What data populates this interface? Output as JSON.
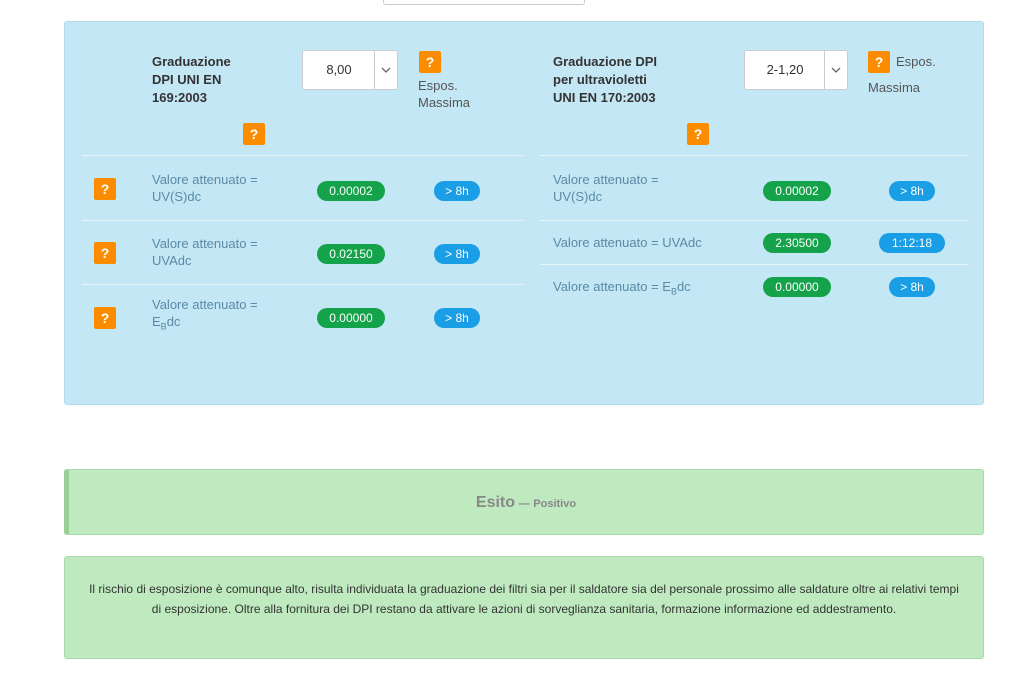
{
  "left": {
    "title_lines": [
      "Graduazione",
      "DPI UNI EN",
      "169:2003"
    ],
    "select_value": "8,00",
    "espos_lines": [
      "Espos.",
      "Massima"
    ],
    "rows": [
      {
        "label_lines": [
          "Valore attenuato =",
          "UV(S)dc"
        ],
        "value": "0.00002",
        "time": "> 8h"
      },
      {
        "label_lines": [
          "Valore attenuato =",
          "UVAdc"
        ],
        "value": "0.02150",
        "time": "> 8h"
      },
      {
        "label_main": "Valore attenuato =",
        "label_e": "E",
        "label_sub": "B",
        "label_tail": "dc",
        "value": "0.00000",
        "time": "> 8h"
      }
    ]
  },
  "right": {
    "title_lines": [
      "Graduazione DPI",
      "per ultravioletti",
      "UNI EN 170:2003"
    ],
    "select_value": "2-1,20",
    "espos_lines": [
      "Espos.",
      "Massima"
    ],
    "rows": [
      {
        "label_lines": [
          "Valore attenuato =",
          "UV(S)dc"
        ],
        "value": "0.00002",
        "time": "> 8h"
      },
      {
        "label": "Valore attenuato = UVAdc",
        "value": "2.30500",
        "time": "1:12:18"
      },
      {
        "label_pre": "Valore attenuato = E",
        "label_sub": "B",
        "label_tail": "dc",
        "value": "0.00000",
        "time": "> 8h"
      }
    ]
  },
  "help_label": "?",
  "result": {
    "title": "Esito",
    "dash": "—",
    "value": "Positivo"
  },
  "note": "Il rischio di esposizione è comunque alto, risulta individuata la graduazione dei filtri sia per il saldatore sia del personale prossimo alle saldature oltre ai relativi tempi di esposizione. Oltre alla fornitura dei DPI restano da attivare le azioni di sorveglianza sanitaria, formazione informazione ed addestramento.",
  "colors": {
    "panel": "#c4e7f5",
    "help": "#fb8c00",
    "green_badge": "#14a34a",
    "blue_badge": "#1a9ee6",
    "result": "#bfeabf"
  }
}
